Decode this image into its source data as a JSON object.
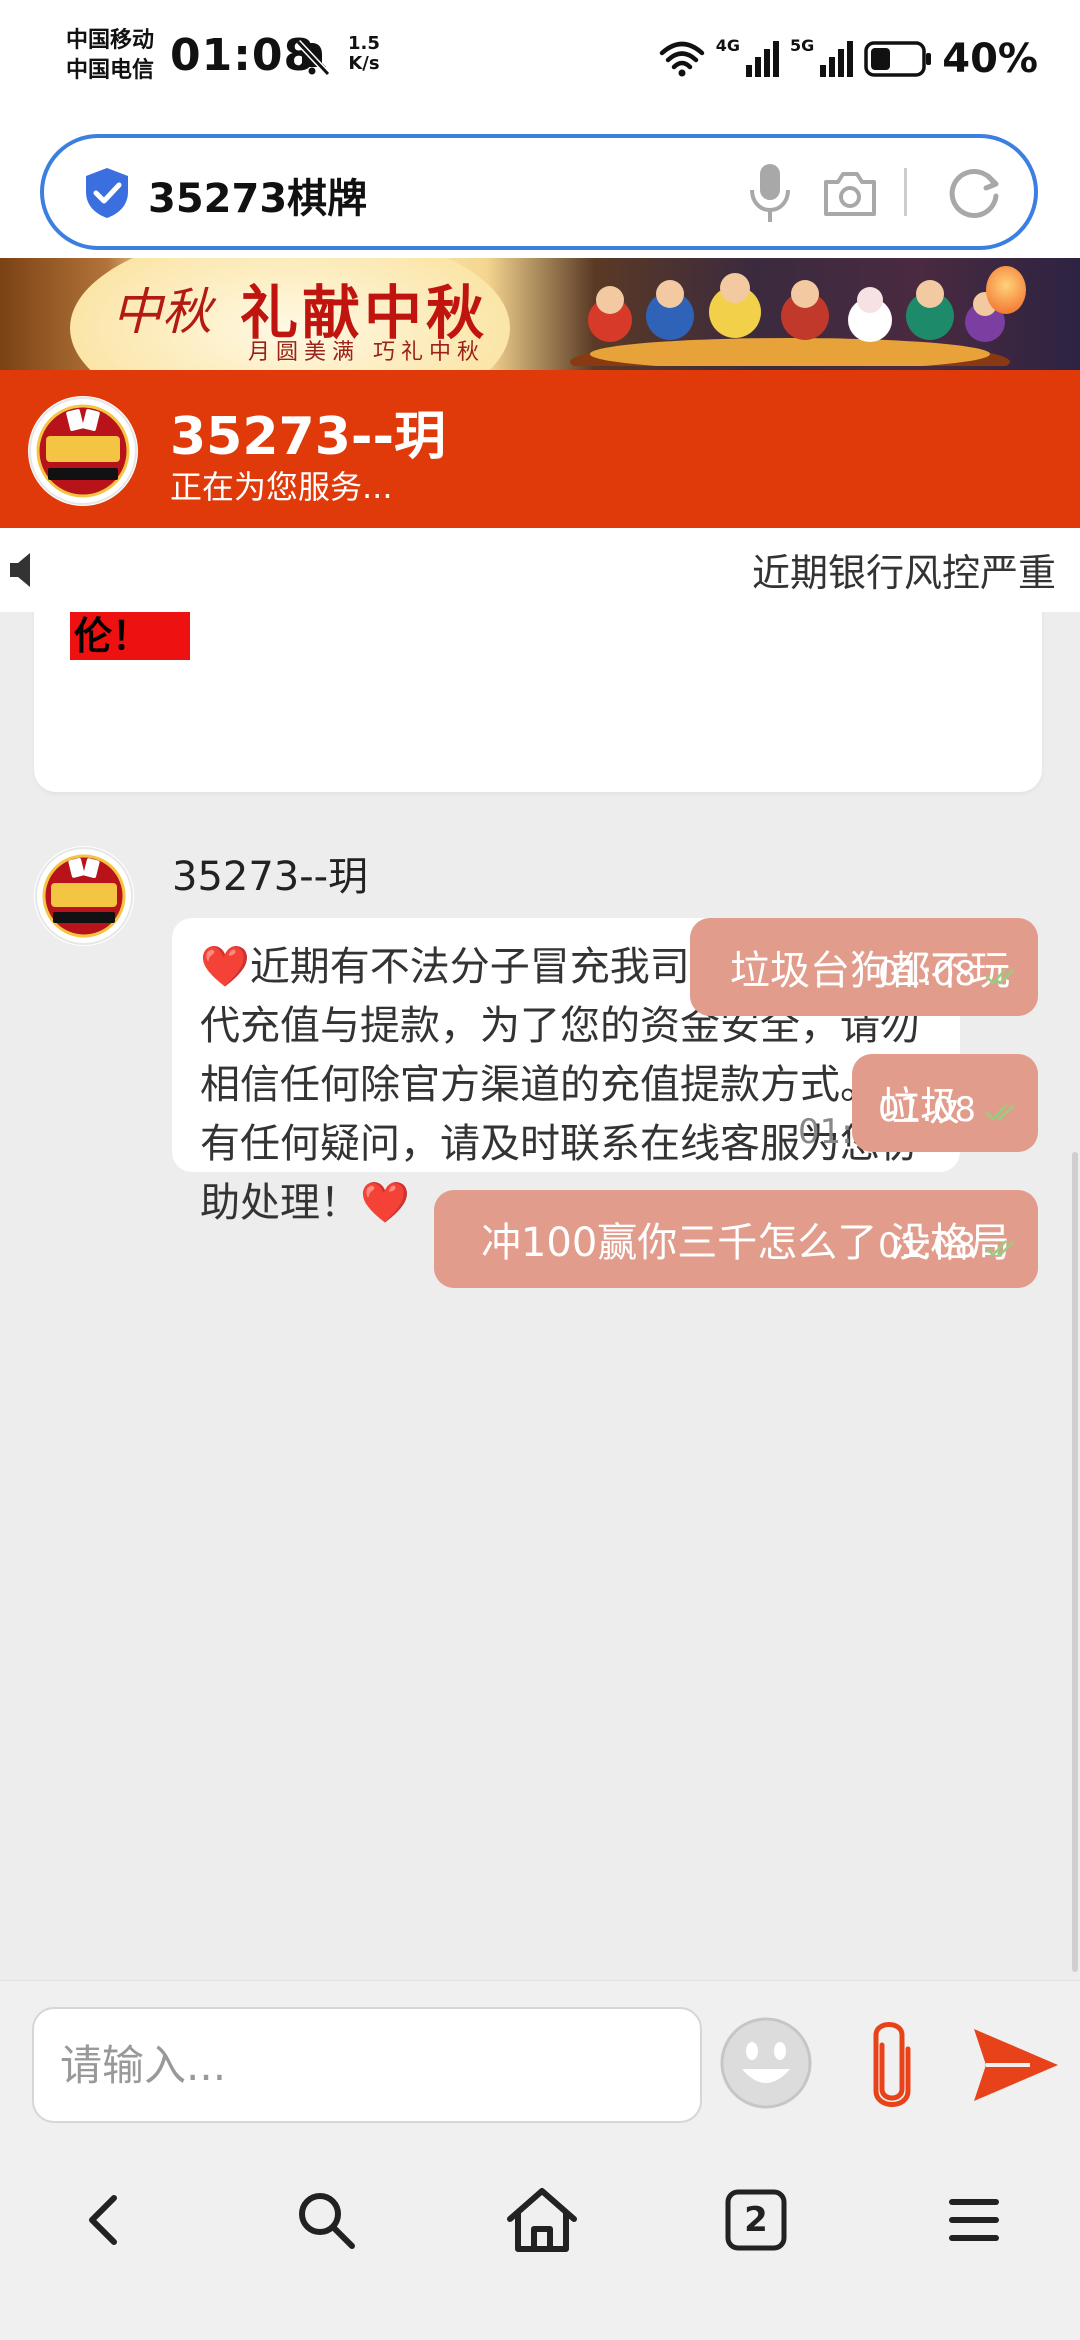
{
  "status_bar": {
    "carrier_1": "中国移动",
    "carrier_2": "中国电信",
    "time": "01:08",
    "speed_value": "1.5",
    "speed_unit": "K/s",
    "net_1": "4G",
    "net_2": "5G",
    "battery_percent": "40%",
    "battery_level": 0.4
  },
  "browser": {
    "url": "35273棋牌"
  },
  "banner": {
    "calligraphy": "中秋",
    "title": "礼献中秋",
    "subtitle": "月圆美满 巧礼中秋"
  },
  "chat_header": {
    "name": "35273--玥",
    "status": "正在为您服务..."
  },
  "marquee": {
    "text": "近期银行风控严重"
  },
  "chat": {
    "previous_snippet": "伦！",
    "incoming": {
      "sender": "35273--玥",
      "heart": "❤️",
      "text": "近期有不法分子冒充我司工作人员进行代充值与提款，为了您的资金安全，请勿相信任何除官方渠道的充值提款方式。如有任何疑问，请及时联系在线客服为您协助处理！",
      "time": "01:08"
    },
    "outgoing": [
      {
        "text": "垃圾台狗都不玩",
        "time": "01:08"
      },
      {
        "text": "垃圾",
        "time": "01:08"
      },
      {
        "text": "冲100赢你三千怎么了 没格局",
        "time": "01:08"
      }
    ]
  },
  "input": {
    "placeholder": "请输入..."
  },
  "bottom_nav": {
    "tab_count": "2"
  },
  "colors": {
    "header": "#e03a0a",
    "outgoing_bubble": "#e29c8c",
    "send": "#e8421a",
    "address_border": "#3b7fe0"
  }
}
